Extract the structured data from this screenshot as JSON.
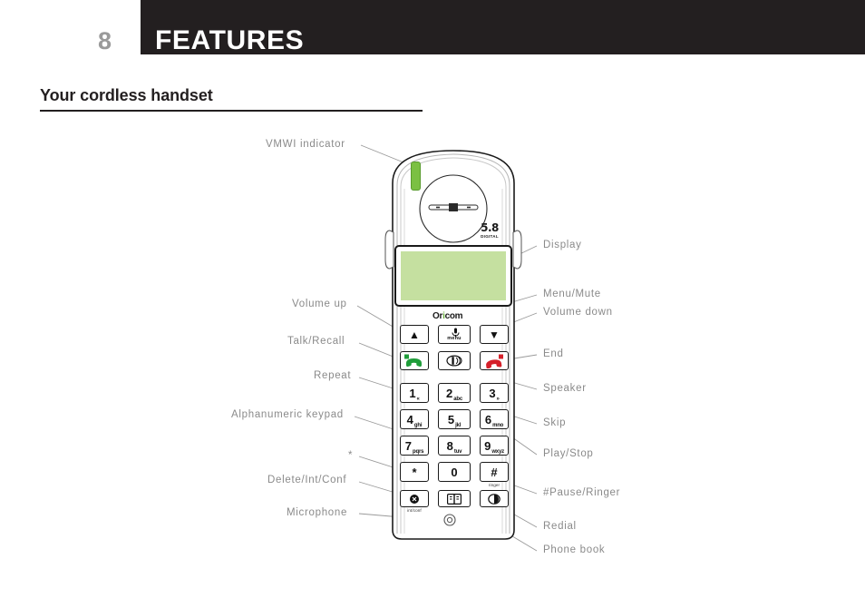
{
  "header": {
    "page_number": "8",
    "title": "FEATURES",
    "band_color": "#231f20",
    "page_number_color": "#9a9a9a"
  },
  "section": {
    "title": "Your cordless handset"
  },
  "figure": {
    "device_brand": "Oricom",
    "device_logo_main": "5.8",
    "device_logo_sub": "DIGITAL",
    "display_color": "#c5e0a0",
    "indicator_color": "#7bc043",
    "callout_color": "#8a8a8a",
    "labels_left": [
      {
        "text": "VMWI indicator"
      },
      {
        "text": "Volume up"
      },
      {
        "text": "Talk/Recall"
      },
      {
        "text": "Repeat"
      },
      {
        "text": "Alphanumeric keypad"
      },
      {
        "text": "*"
      },
      {
        "text": "Delete/Int/Conf"
      },
      {
        "text": "Microphone"
      }
    ],
    "labels_right": [
      {
        "text": "Display"
      },
      {
        "text": "Menu/Mute"
      },
      {
        "text": "Volume down"
      },
      {
        "text": "End"
      },
      {
        "text": "Speaker"
      },
      {
        "text": "Skip"
      },
      {
        "text": "Play/Stop"
      },
      {
        "text": "#Pause/Ringer"
      },
      {
        "text": "Redial"
      },
      {
        "text": "Phone book"
      }
    ],
    "keypad": {
      "row_nav": [
        {
          "name": "volume-up",
          "glyph": "▲"
        },
        {
          "name": "menu",
          "glyph": "",
          "sub": "menu"
        },
        {
          "name": "volume-down",
          "glyph": "▼"
        }
      ],
      "row_call": [
        {
          "name": "talk",
          "glyph": ""
        },
        {
          "name": "speaker",
          "glyph": ""
        },
        {
          "name": "end",
          "glyph": ""
        }
      ],
      "digits": [
        {
          "digit": "1",
          "letters": "«"
        },
        {
          "digit": "2",
          "letters": "abc"
        },
        {
          "digit": "3",
          "letters": "»"
        },
        {
          "digit": "4",
          "letters": "ghi"
        },
        {
          "digit": "5",
          "letters": "jkl"
        },
        {
          "digit": "6",
          "letters": "mno"
        },
        {
          "digit": "7",
          "letters": "pqrs"
        },
        {
          "digit": "8",
          "letters": "tuv"
        },
        {
          "digit": "9",
          "letters": "wxyz"
        },
        {
          "digit": "*",
          "letters": ""
        },
        {
          "digit": "0",
          "letters": ""
        },
        {
          "digit": "#",
          "letters": "",
          "sub": "ringer"
        }
      ],
      "row_bottom": [
        {
          "name": "int-conf",
          "sub": "int/conf"
        },
        {
          "name": "phone-book",
          "sub": ""
        },
        {
          "name": "redial",
          "sub": ""
        }
      ]
    }
  }
}
